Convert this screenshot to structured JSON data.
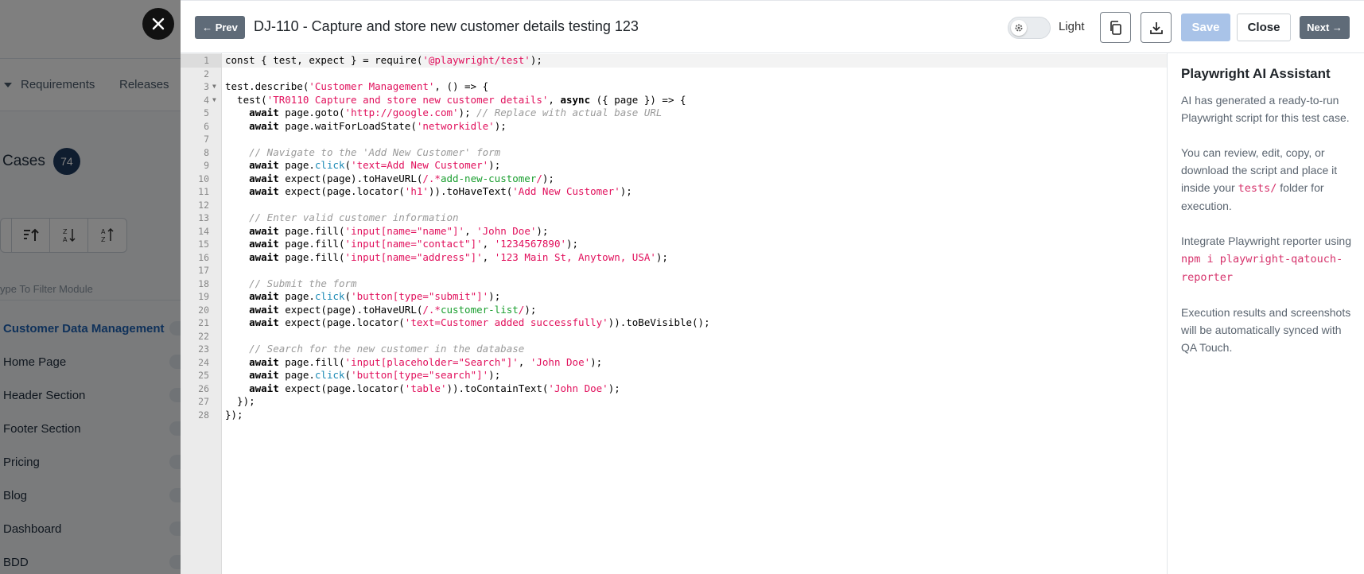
{
  "background": {
    "nav": {
      "requirements": "Requirements",
      "releases": "Releases"
    },
    "cases": {
      "label": "Cases",
      "count": "74"
    },
    "filter_placeholder": "ype To Filter Module",
    "modules": [
      "Customer Data Management",
      "Home Page",
      "Header Section",
      "Footer Section",
      "Pricing",
      "Blog",
      "Dashboard",
      "BDD"
    ]
  },
  "header": {
    "prev_label": "← Prev",
    "title": "DJ-110 - Capture and store new customer details testing 123",
    "theme_label": "Light",
    "save_label": "Save",
    "close_label": "Close",
    "next_label": "Next →"
  },
  "editor": {
    "language": "javascript",
    "lines": [
      "const { test, expect } = require('@playwright/test');",
      "",
      "test.describe('Customer Management', () => {",
      "  test('TR0110 Capture and store new customer details', async ({ page }) => {",
      "    await page.goto('http://google.com'); // Replace with actual base URL",
      "    await page.waitForLoadState('networkidle');",
      "",
      "    // Navigate to the 'Add New Customer' form",
      "    await page.click('text=Add New Customer');",
      "    await expect(page).toHaveURL(/.*add-new-customer/);",
      "    await expect(page.locator('h1')).toHaveText('Add New Customer');",
      "",
      "    // Enter valid customer information",
      "    await page.fill('input[name=\"name\"]', 'John Doe');",
      "    await page.fill('input[name=\"contact\"]', '1234567890');",
      "    await page.fill('input[name=\"address\"]', '123 Main St, Anytown, USA');",
      "",
      "    // Submit the form",
      "    await page.click('button[type=\"submit\"]');",
      "    await expect(page).toHaveURL(/.*customer-list/);",
      "    await expect(page.locator('text=Customer added successfully')).toBeVisible();",
      "",
      "    // Search for the new customer in the database",
      "    await page.fill('input[placeholder=\"Search\"]', 'John Doe');",
      "    await page.click('button[type=\"search\"]');",
      "    await expect(page.locator('table')).toContainText('John Doe');",
      "  });",
      "});"
    ]
  },
  "assistant": {
    "title": "Playwright AI Assistant",
    "p1": "AI has generated a ready-to-run Playwright script for this test case.",
    "p2_before": "You can review, edit, copy, or download the script and place it inside your",
    "p2_code": "tests/",
    "p2_after": "folder for execution.",
    "p3_text": "Integrate Playwright reporter using",
    "p3_code": "npm i playwright-qatouch-reporter",
    "p4": "Execution results and screenshots will be automatically synced with QA Touch."
  },
  "colors": {
    "prev_next_bg": "#5f6b78",
    "save_bg": "#a9c3e8",
    "string": "#e1105c",
    "comment": "#9a9a9a",
    "method": "#1c8ab5",
    "regex": "#1a9e2f",
    "active_module": "#1e63b5"
  }
}
